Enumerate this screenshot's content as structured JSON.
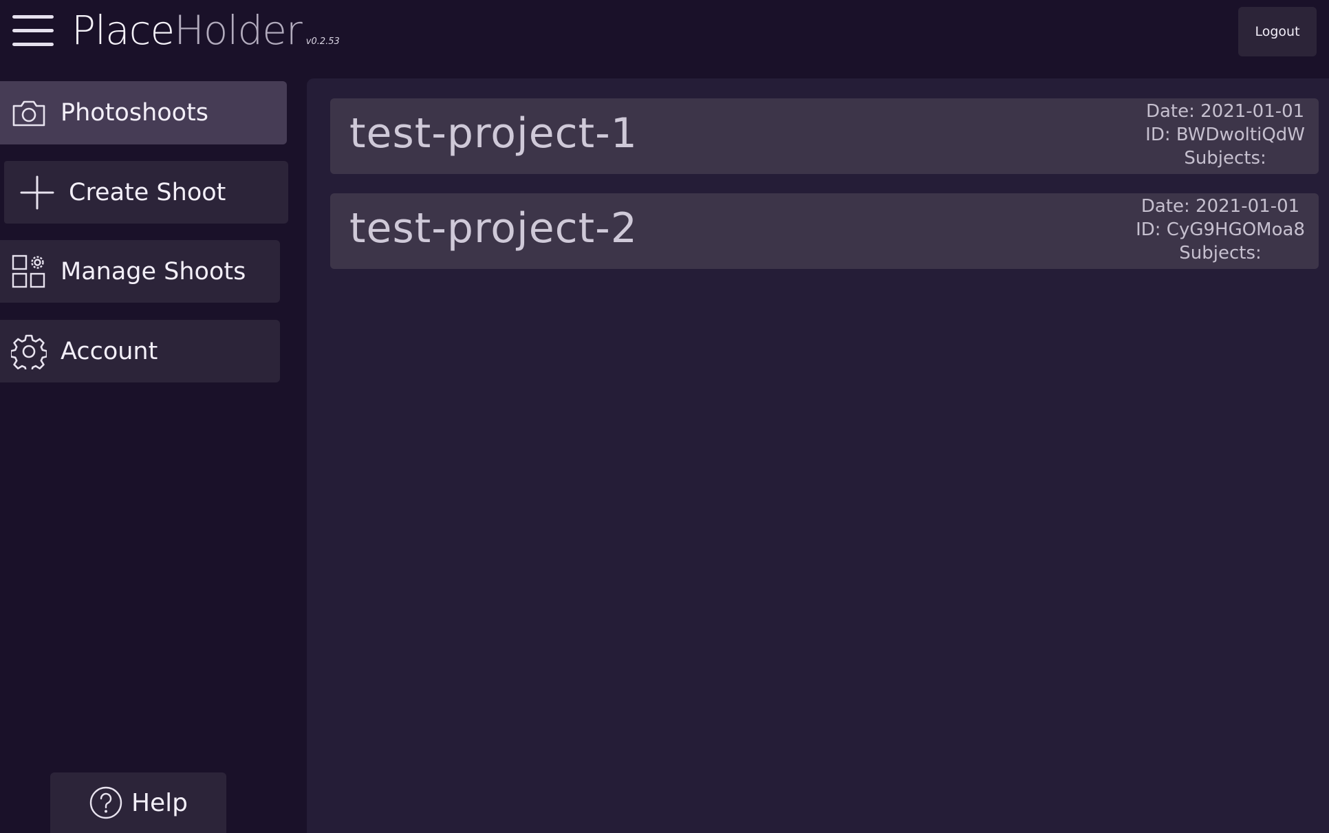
{
  "header": {
    "brand_place": "Place",
    "brand_holder": "Holder",
    "version": "v0.2.53",
    "logout_label": "Logout"
  },
  "sidebar": {
    "items": [
      {
        "label": "Photoshoots",
        "icon": "camera-icon",
        "active": true
      },
      {
        "label": "Create Shoot",
        "icon": "plus-icon",
        "active": false
      },
      {
        "label": "Manage Shoots",
        "icon": "grid-gear-icon",
        "active": false
      },
      {
        "label": "Account",
        "icon": "gear-icon",
        "active": false
      }
    ],
    "help_label": "Help"
  },
  "projects": [
    {
      "name": "test-project-1",
      "date": "Date: 2021-01-01",
      "id": "ID: BWDwoltiQdW",
      "subjects": "Subjects:"
    },
    {
      "name": "test-project-2",
      "date": "Date: 2021-01-01",
      "id": "ID: CyG9HGOMoa8",
      "subjects": "Subjects:"
    }
  ],
  "colors": {
    "background": "#1a1129",
    "main_panel": "#251d37",
    "card": "#3d3549",
    "nav_active": "#463c55",
    "nav_inactive": "#2c2439"
  }
}
